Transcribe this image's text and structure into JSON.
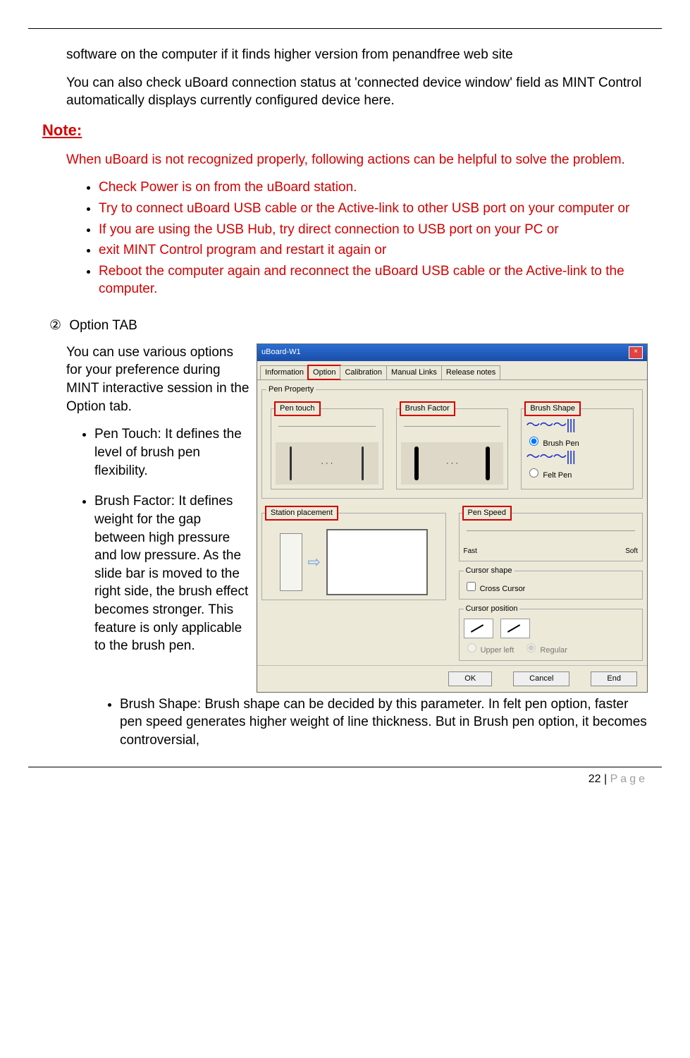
{
  "intro": {
    "line1": "software on the computer if it finds higher version from penandfree web site",
    "line2": "You can also check uBoard connection status at 'connected device window' field as MINT Control automatically displays currently configured device here."
  },
  "note": {
    "heading": "Note:",
    "lead": "When uBoard is not recognized properly, following actions can be helpful to solve the problem.",
    "items": [
      "Check Power is on from the uBoard station.",
      "Try to connect uBoard USB cable or the Active-link to other USB port on your computer or",
      "If you are using the USB Hub, try direct connection to USB port on your PC or",
      "exit MINT Control program and restart it again or",
      "Reboot the computer again and reconnect the uBoard USB cable or the Active-link to the computer."
    ]
  },
  "section": {
    "marker": "②",
    "title": "Option TAB",
    "intro": "You can use various options for your preference during MINT interactive session in the Option tab.",
    "bullets": [
      "Pen Touch: It defines the level of brush pen flexibility.",
      "Brush Factor: It defines weight for the gap between high pressure and low pressure. As the slide bar is moved to the right side, the brush effect becomes stronger. This feature is only applicable to the brush pen.",
      "Brush Shape: Brush shape can be decided by this parameter. In felt pen option, faster pen speed generates higher weight of line thickness.    But in Brush pen option, it becomes controversial,"
    ]
  },
  "dialog": {
    "title": "uBoard-W1",
    "close_icon": "×",
    "tabs": [
      "Information",
      "Option",
      "Calibration",
      "Manual Links",
      "Release notes"
    ],
    "active_tab": 1,
    "pen_property_legend": "Pen Property",
    "pen_touch_label": "Pen touch",
    "brush_factor_label": "Brush Factor",
    "brush_shape_label": "Brush Shape",
    "brush_pen_option": "Brush Pen",
    "felt_pen_option": "Felt Pen",
    "station_placement_label": "Station placement",
    "pen_speed_label": "Pen Speed",
    "fast_label": "Fast",
    "soft_label": "Soft",
    "cursor_shape_label": "Cursor shape",
    "cross_cursor_label": "Cross Cursor",
    "cursor_position_label": "Cursor position",
    "upper_left_label": "Upper left",
    "regular_label": "Regular",
    "buttons": {
      "ok": "OK",
      "cancel": "Cancel",
      "end": "End"
    }
  },
  "footer": {
    "page_number": "22",
    "page_label": "Page"
  }
}
